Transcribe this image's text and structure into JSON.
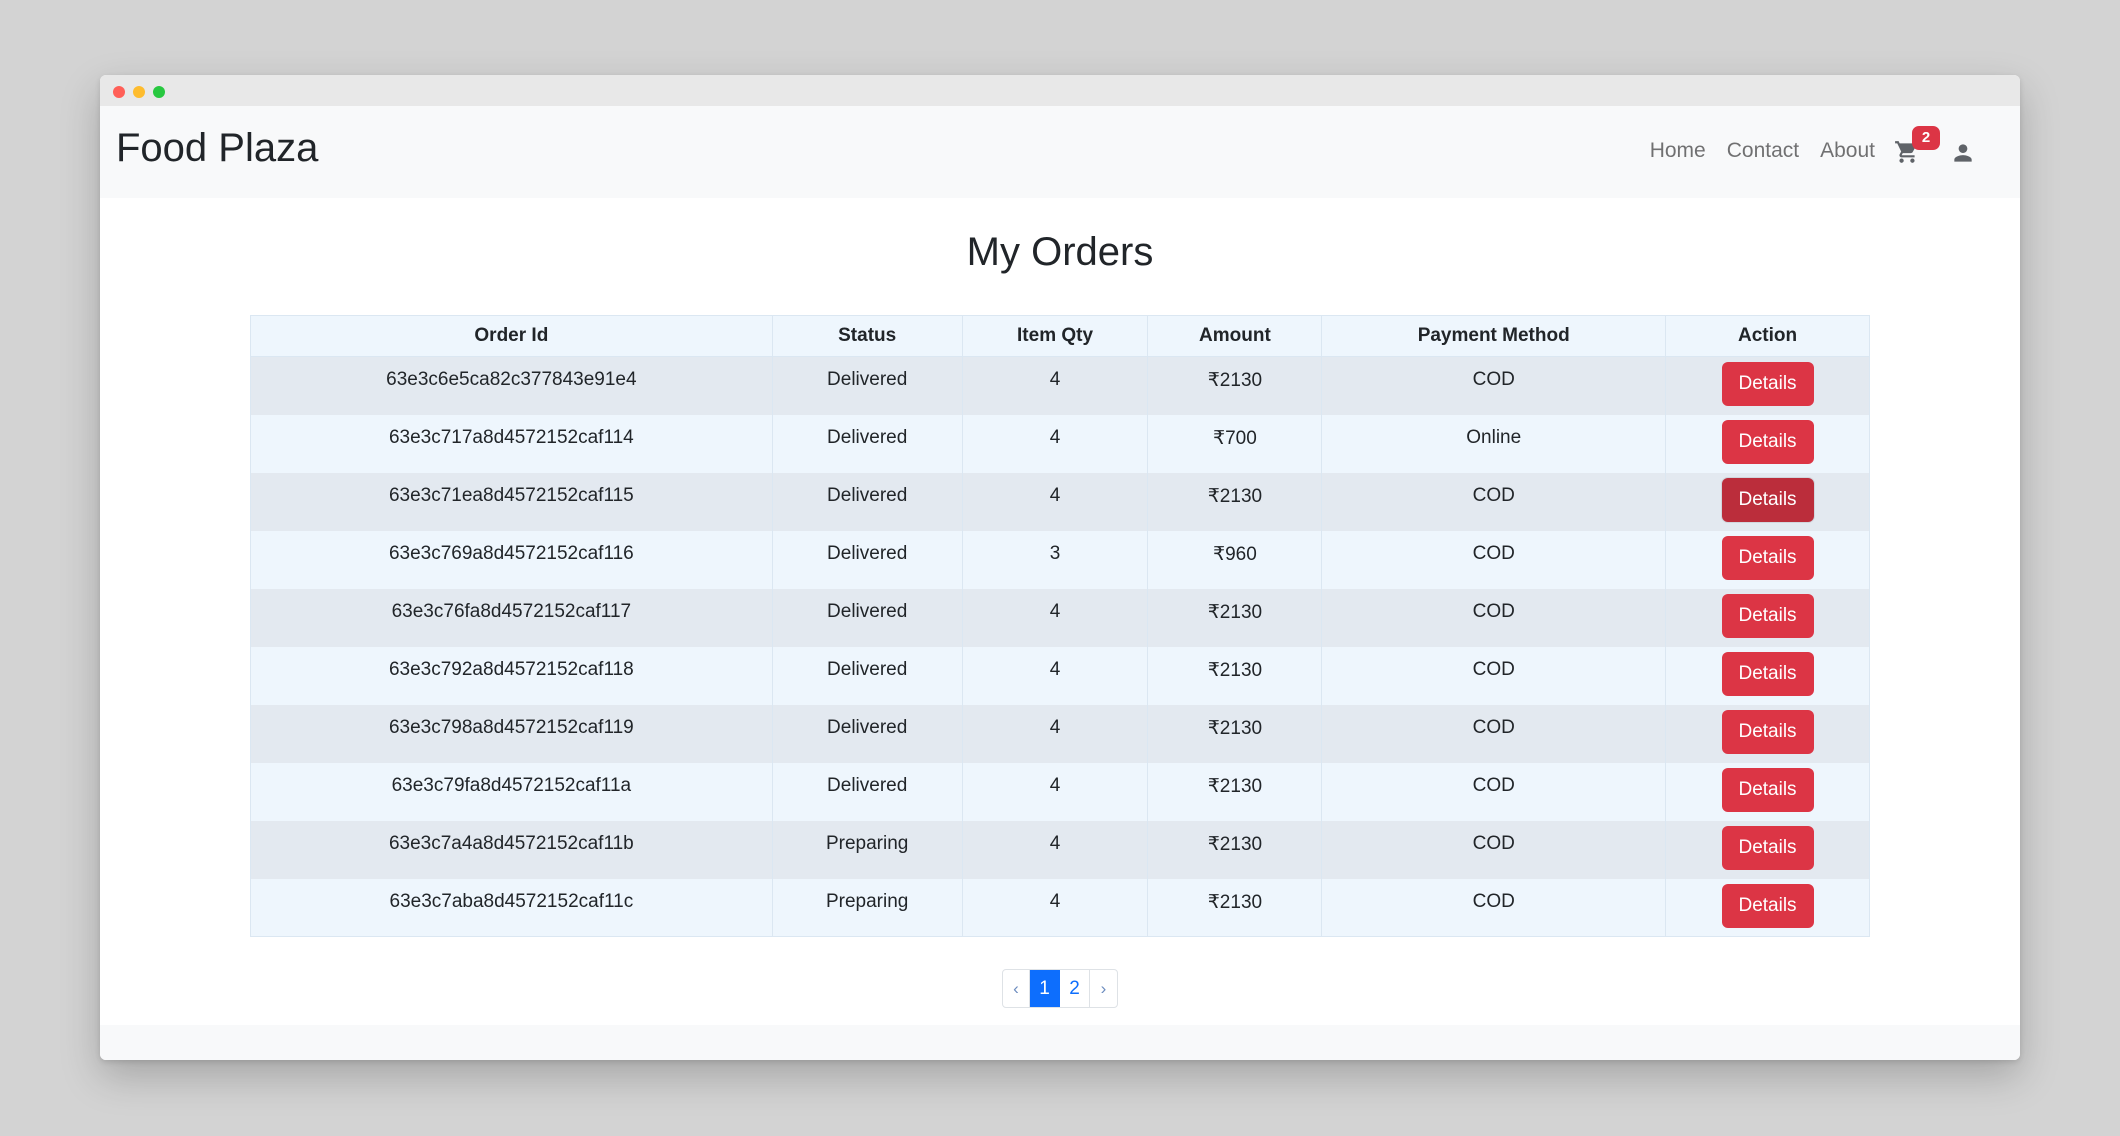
{
  "app": {
    "brand": "Food Plaza"
  },
  "nav": {
    "links": [
      "Home",
      "Contact",
      "About"
    ],
    "cart_count": "2",
    "cart_icon": "cart-icon",
    "user_icon": "user-icon"
  },
  "page": {
    "title": "My Orders"
  },
  "table": {
    "headers": [
      "Order Id",
      "Status",
      "Item Qty",
      "Amount",
      "Payment Method",
      "Action"
    ],
    "rows": [
      {
        "order_id": "63e3c6e5ca82c377843e91e4",
        "status": "Delivered",
        "qty": "4",
        "amount": "₹2130",
        "payment": "COD",
        "action": "Details"
      },
      {
        "order_id": "63e3c717a8d4572152caf114",
        "status": "Delivered",
        "qty": "4",
        "amount": "₹700",
        "payment": "Online",
        "action": "Details"
      },
      {
        "order_id": "63e3c71ea8d4572152caf115",
        "status": "Delivered",
        "qty": "4",
        "amount": "₹2130",
        "payment": "COD",
        "action": "Details"
      },
      {
        "order_id": "63e3c769a8d4572152caf116",
        "status": "Delivered",
        "qty": "3",
        "amount": "₹960",
        "payment": "COD",
        "action": "Details"
      },
      {
        "order_id": "63e3c76fa8d4572152caf117",
        "status": "Delivered",
        "qty": "4",
        "amount": "₹2130",
        "payment": "COD",
        "action": "Details"
      },
      {
        "order_id": "63e3c792a8d4572152caf118",
        "status": "Delivered",
        "qty": "4",
        "amount": "₹2130",
        "payment": "COD",
        "action": "Details"
      },
      {
        "order_id": "63e3c798a8d4572152caf119",
        "status": "Delivered",
        "qty": "4",
        "amount": "₹2130",
        "payment": "COD",
        "action": "Details"
      },
      {
        "order_id": "63e3c79fa8d4572152caf11a",
        "status": "Delivered",
        "qty": "4",
        "amount": "₹2130",
        "payment": "COD",
        "action": "Details"
      },
      {
        "order_id": "63e3c7a4a8d4572152caf11b",
        "status": "Preparing",
        "qty": "4",
        "amount": "₹2130",
        "payment": "COD",
        "action": "Details"
      },
      {
        "order_id": "63e3c7aba8d4572152caf11c",
        "status": "Preparing",
        "qty": "4",
        "amount": "₹2130",
        "payment": "COD",
        "action": "Details"
      }
    ]
  },
  "pagination": {
    "prev": "‹",
    "pages": [
      "1",
      "2"
    ],
    "current": "1",
    "next": "›"
  },
  "colors": {
    "danger": "#dc3545",
    "danger_hover": "#bb2d3b",
    "primary": "#0d6efd"
  }
}
